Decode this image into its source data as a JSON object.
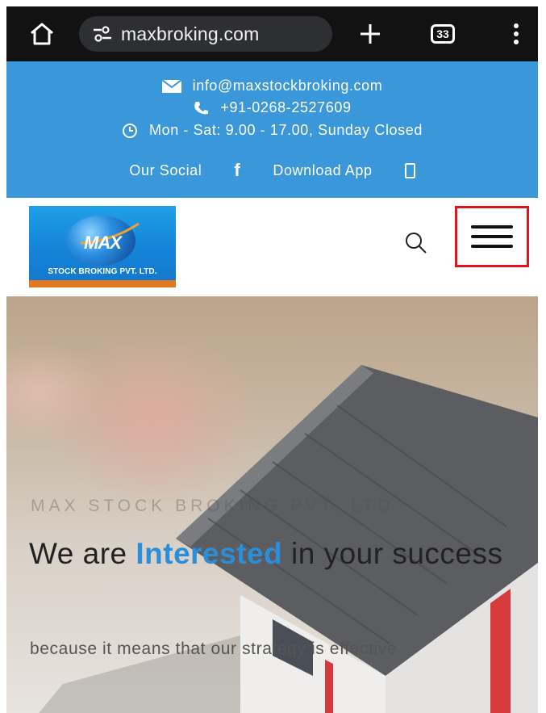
{
  "browser": {
    "url": "maxbroking.com",
    "tab_count": "33"
  },
  "topbar": {
    "email": "info@maxstockbroking.com",
    "phone": "+91-0268-2527609",
    "hours": "Mon - Sat: 9.00 - 17.00, Sunday Closed",
    "social_label": "Our Social",
    "facebook_glyph": "f",
    "download_label": "Download App",
    "bg_color": "#3a97da"
  },
  "logo": {
    "wordmark": "MAX",
    "tagline": "STOCK BROKING PVT. LTD."
  },
  "hero": {
    "eyebrow": "MAX STOCK BROKING PVT. LTD.",
    "headline_pre": "We are ",
    "headline_accent": "Interested",
    "headline_post": " in your success",
    "subtitle": "because it means that our strategy is effective",
    "accent_color": "#2b8ed9"
  },
  "icons": [
    "home-icon",
    "site-settings-icon",
    "plus-icon",
    "tabs-icon",
    "menu-dots-icon",
    "envelope-icon",
    "phone-icon",
    "clock-icon",
    "facebook-icon",
    "phone-app-icon",
    "search-icon",
    "hamburger-menu-icon"
  ]
}
